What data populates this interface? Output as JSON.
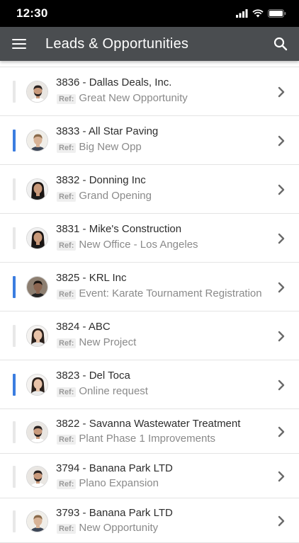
{
  "status_bar": {
    "time": "12:30"
  },
  "app_bar": {
    "title": "Leads & Opportunities"
  },
  "colors": {
    "header": "#4a4d50",
    "active_indicator": "#3b7de0",
    "inactive_indicator": "#e8e8e8"
  },
  "ref_label": "Ref:",
  "leads": [
    {
      "title": "3836 - Dallas Deals, Inc.",
      "ref": "Great New Opportunity",
      "active": false,
      "avatar": "man-beard"
    },
    {
      "title": "3833 - All Star Paving",
      "ref": "Big New Opp",
      "active": true,
      "avatar": "man-suit"
    },
    {
      "title": "3832 - Donning Inc",
      "ref": "Grand Opening",
      "active": false,
      "avatar": "woman-dark-hair"
    },
    {
      "title": "3831 - Mike's Construction",
      "ref": "New Office - Los Angeles",
      "active": false,
      "avatar": "woman-dark-hair"
    },
    {
      "title": "3825 - KRL Inc",
      "ref": "Event: Karate Tournament Registration",
      "active": true,
      "avatar": "man-dark"
    },
    {
      "title": "3824 - ABC",
      "ref": "New Project",
      "active": false,
      "avatar": "woman-light"
    },
    {
      "title": "3823 - Del Toca",
      "ref": "Online request",
      "active": true,
      "avatar": "woman-light"
    },
    {
      "title": "3822 - Savanna Wastewater Treatment",
      "ref": "Plant Phase 1 Improvements",
      "active": false,
      "avatar": "man-beard"
    },
    {
      "title": "3794 - Banana Park LTD",
      "ref": "Plano Expansion",
      "active": false,
      "avatar": "man-beard"
    },
    {
      "title": "3793 - Banana Park LTD",
      "ref": "New Opportunity",
      "active": false,
      "avatar": "man-suit"
    }
  ]
}
